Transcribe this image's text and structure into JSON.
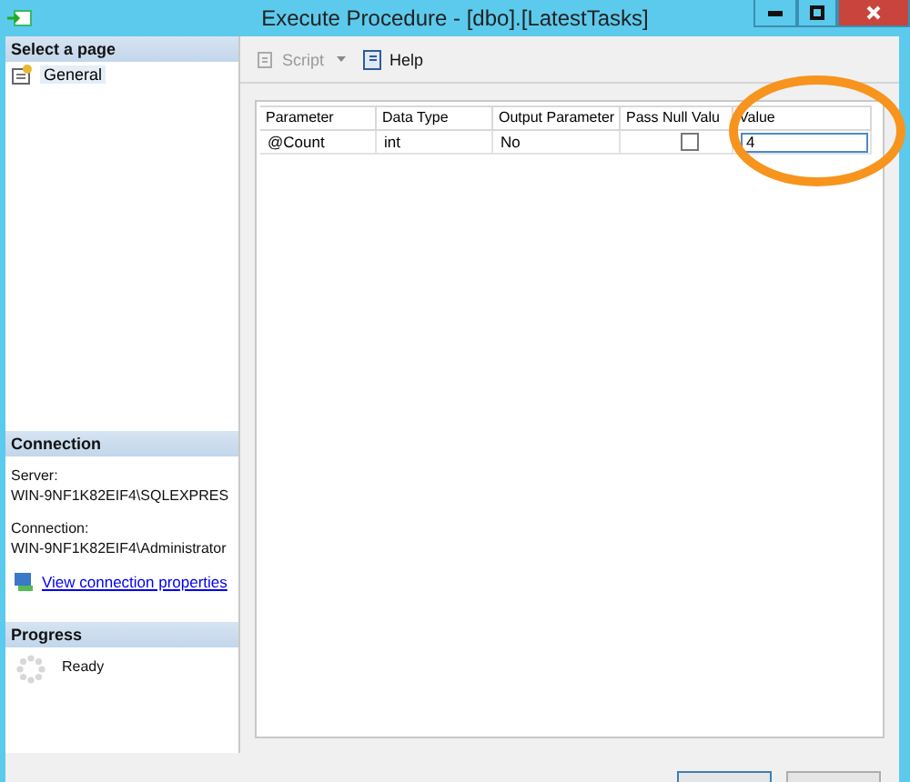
{
  "window": {
    "title": "Execute Procedure - [dbo].[LatestTasks]"
  },
  "sidebar": {
    "header": "Select a page",
    "pages": [
      {
        "label": "General",
        "selected": true
      }
    ]
  },
  "connection": {
    "header": "Connection",
    "server_label": "Server:",
    "server": "WIN-9NF1K82EIF4\\SQLEXPRES",
    "connection_label": "Connection:",
    "connection": "WIN-9NF1K82EIF4\\Administrator",
    "link": "View connection properties"
  },
  "progress": {
    "header": "Progress",
    "status": "Ready"
  },
  "toolbar": [
    {
      "kind": "script",
      "label": "Script",
      "disabled": true,
      "has_menu": true
    },
    {
      "kind": "help",
      "label": "Help",
      "disabled": false,
      "has_menu": false
    }
  ],
  "grid": {
    "columns": [
      "Parameter",
      "Data Type",
      "Output Parameter",
      "Pass Null Valu",
      "Value"
    ],
    "rows": [
      {
        "parameter": "@Count",
        "data_type": "int",
        "output_parameter": "No",
        "pass_null_value": false,
        "value": "4"
      }
    ]
  }
}
